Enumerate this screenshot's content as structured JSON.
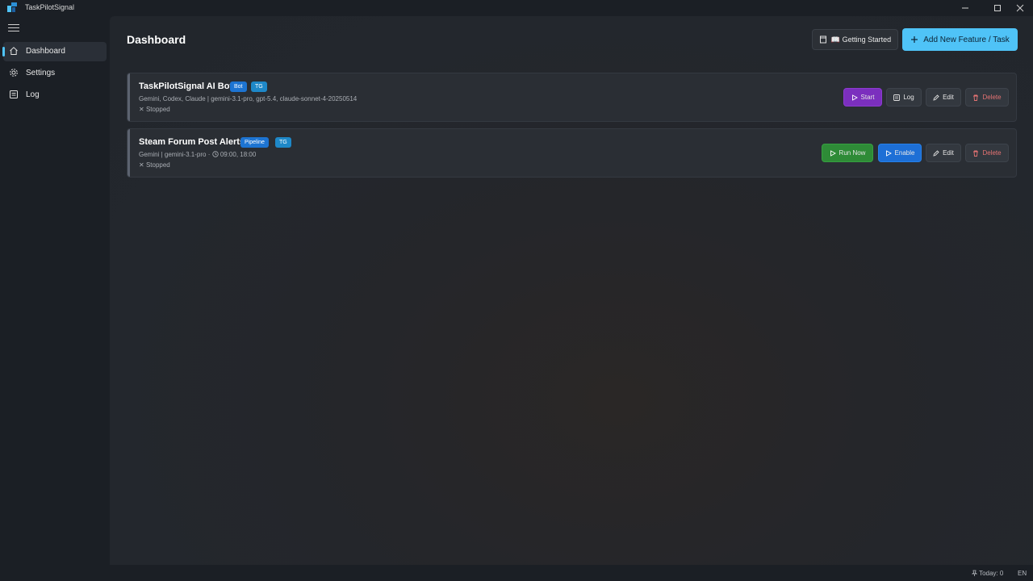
{
  "app": {
    "title": "TaskPilotSignal"
  },
  "sidebar": {
    "items": [
      {
        "label": "Dashboard",
        "icon": "home-icon",
        "active": true
      },
      {
        "label": "Settings",
        "icon": "gear-icon",
        "active": false
      },
      {
        "label": "Log",
        "icon": "log-icon",
        "active": false
      }
    ]
  },
  "header": {
    "title": "Dashboard",
    "getting_started_label": "📖 Getting Started",
    "add_label": "Add New Feature / Task"
  },
  "tasks": [
    {
      "name": "TaskPilotSignal AI Bot",
      "badges": [
        "Bot",
        "TG"
      ],
      "subtitle": "Gemini, Codex, Claude | gemini-3.1-pro, gpt-5.4, claude-sonnet-4-20250514",
      "status": "Stopped",
      "actions": [
        "Start",
        "Log",
        "Edit",
        "Delete"
      ]
    },
    {
      "name": "Steam Forum Post Alerts",
      "badges": [
        "Pipeline",
        "TG"
      ],
      "subtitle": "Gemini | gemini-3.1-pro",
      "schedule": "09:00, 18:00",
      "status": "Stopped",
      "actions": [
        "Run Now",
        "Enable",
        "Edit",
        "Delete"
      ]
    }
  ],
  "statusbar": {
    "today": "Today: 0",
    "lang": "EN"
  },
  "colors": {
    "accent": "#4fc3f7",
    "start": "#7b2fbe",
    "run_now": "#2e8b37",
    "enable": "#1d6fd6",
    "delete": "#e57373"
  }
}
